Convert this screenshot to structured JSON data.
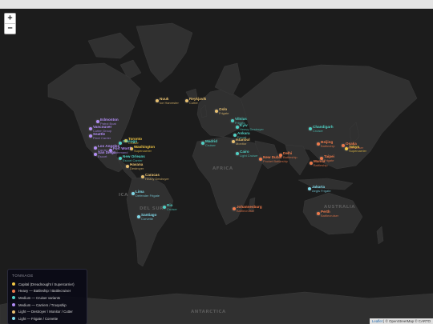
{
  "zoom": {
    "in_label": "+",
    "out_label": "−"
  },
  "colors": {
    "capital": "#f2c744",
    "heavy": "#ef7a4a",
    "medium_cruiser": "#4fd1c5",
    "medium_carrier": "#b18cf5",
    "light_destroyer": "#e8c070",
    "light_frigate": "#7fd8e8",
    "land": "#303030",
    "ocean": "#1c1c1c"
  },
  "regions": {
    "africa": "AFRICA",
    "australia": "AUSTRALIA",
    "antarctica": "ANTARCTICA",
    "south_america": "DEL SUR",
    "north_america": "ICA"
  },
  "ports": [
    {
      "name": "Nuuk",
      "ship": "Ice Harvester",
      "cls": "light_destroyer"
    },
    {
      "name": "Reykjavik",
      "ship": "Cutter",
      "cls": "light_destroyer"
    },
    {
      "name": "Edmonton",
      "ship": "Patrol Boat",
      "cls": "medium_carrier"
    },
    {
      "name": "Vancouver",
      "ship": "Cutter Group",
      "cls": "medium_carrier"
    },
    {
      "name": "Seattle",
      "ship": "Fleet Carrier",
      "cls": "medium_carrier"
    },
    {
      "name": "Toronto",
      "ship": "Cruiser",
      "cls": "capital"
    },
    {
      "name": "Chicago",
      "ship": "",
      "cls": "medium_cruiser"
    },
    {
      "name": "Washington",
      "ship": "Supercarrier",
      "cls": "capital"
    },
    {
      "name": "Los Angeles",
      "ship": "Carrier",
      "cls": "medium_carrier"
    },
    {
      "name": "San Diego",
      "ship": "Escort",
      "cls": "medium_carrier"
    },
    {
      "name": "Fort Worth",
      "ship": "Command",
      "cls": "medium_carrier"
    },
    {
      "name": "New Orleans",
      "ship": "Escort Carrier",
      "cls": "medium_cruiser"
    },
    {
      "name": "Havana",
      "ship": "Destroyer",
      "cls": "light_destroyer"
    },
    {
      "name": "Caracas",
      "ship": "Heavy Destroyer",
      "cls": "light_destroyer"
    },
    {
      "name": "Lima",
      "ship": "Defender Frigate",
      "cls": "light_frigate"
    },
    {
      "name": "Santiago",
      "ship": "Corvette",
      "cls": "light_frigate"
    },
    {
      "name": "Rio",
      "ship": "Cruiser",
      "cls": "medium_cruiser"
    },
    {
      "name": "Oslo",
      "ship": "Frigate",
      "cls": "light_destroyer"
    },
    {
      "name": "Vilnius",
      "ship": "Frigate",
      "cls": "medium_cruiser"
    },
    {
      "name": "Kyiv",
      "ship": "Heavy Destroyer",
      "cls": "medium_cruiser"
    },
    {
      "name": "Ankara",
      "ship": "Escort",
      "cls": "medium_cruiser"
    },
    {
      "name": "Istanbul",
      "ship": "Monitor",
      "cls": "light_destroyer"
    },
    {
      "name": "Madrid",
      "ship": "Cruiser",
      "cls": "medium_cruiser"
    },
    {
      "name": "Cairo",
      "ship": "Light Cruiser",
      "cls": "medium_cruiser"
    },
    {
      "name": "New Dubai",
      "ship": "Pocket Battleship",
      "cls": "heavy"
    },
    {
      "name": "Delhi",
      "ship": "Battleship",
      "cls": "heavy"
    },
    {
      "name": "Chandigarh",
      "ship": "Cruiser",
      "cls": "medium_cruiser"
    },
    {
      "name": "Beijing",
      "ship": "Battleship",
      "cls": "heavy"
    },
    {
      "name": "Osaka",
      "ship": "Battlecruiser",
      "cls": "heavy"
    },
    {
      "name": "Tokyo",
      "ship": "Supercarrier",
      "cls": "capital"
    },
    {
      "name": "Taipei",
      "ship": "Frigate",
      "cls": "heavy"
    },
    {
      "name": "Manila",
      "ship": "Battleship",
      "cls": "heavy"
    },
    {
      "name": "Jakarta",
      "ship": "Aegis Frigate",
      "cls": "light_frigate"
    },
    {
      "name": "Perth",
      "ship": "Battlecruiser",
      "cls": "heavy"
    },
    {
      "name": "Johannesburg",
      "ship": "Battlecruiser",
      "cls": "heavy"
    }
  ],
  "legend": {
    "title": "TONNAGE",
    "items": [
      {
        "label": "Capital (Dreadnought / Supercarrier)",
        "cls": "capital"
      },
      {
        "label": "Heavy — Battleship / Battlecruiser",
        "cls": "heavy"
      },
      {
        "label": "Medium — Cruiser variants",
        "cls": "medium_cruiser"
      },
      {
        "label": "Medium — Carriers / Troopship",
        "cls": "medium_carrier"
      },
      {
        "label": "Light — Destroyer / Monitor / Cutter",
        "cls": "light_destroyer"
      },
      {
        "label": "Light — Frigate / Corvette",
        "cls": "light_frigate"
      }
    ]
  },
  "attribution": {
    "link": "Leaflet",
    "text": " | © OpenStreetMap © CARTO"
  }
}
